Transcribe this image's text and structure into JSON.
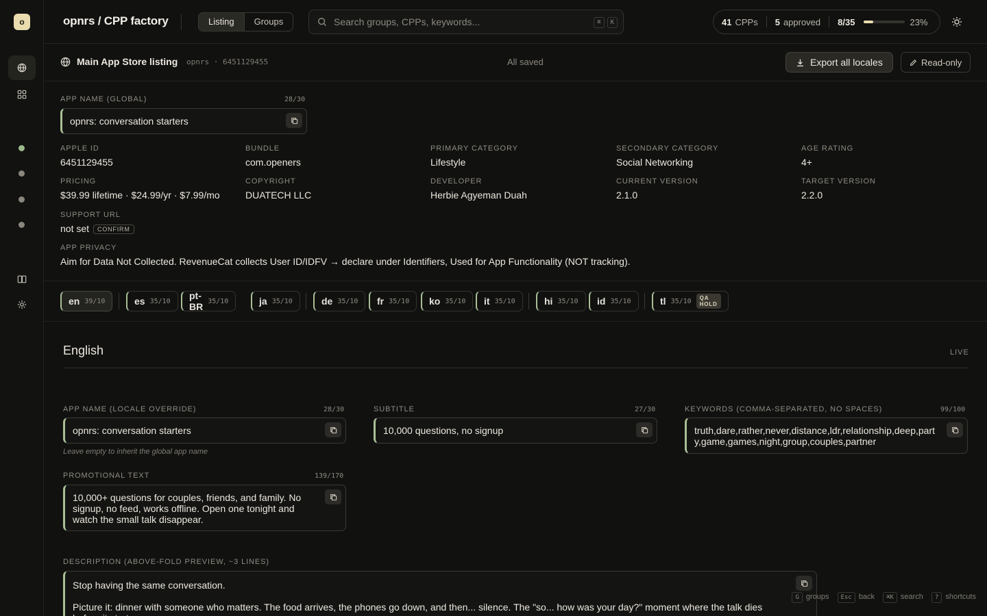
{
  "app": {
    "logo_letter": "o",
    "brand": "opnrs / CPP factory",
    "tabs": [
      "Listing",
      "Groups"
    ],
    "active_tab": "Listing"
  },
  "search": {
    "placeholder": "Search groups, CPPs, keywords...",
    "shortcut_keys": [
      "⌘",
      "K"
    ]
  },
  "stats": {
    "cpps_count": "41",
    "cpps_label": "CPPs",
    "approved_count": "5",
    "approved_label": "approved",
    "progress_text": "8/35",
    "progress_fraction": 0.23,
    "progress_percent": "23%"
  },
  "listing": {
    "title": "Main App Store listing",
    "meta": "opnrs · 6451129455",
    "save_status": "All saved",
    "export_label": "Export all locales",
    "readonly_label": "Read-only"
  },
  "global": {
    "app_name_label": "APP NAME (GLOBAL)",
    "app_name_counter": "28/30",
    "app_name_value": "opnrs: conversation starters",
    "info": [
      {
        "label": "APPLE ID",
        "value": "6451129455"
      },
      {
        "label": "BUNDLE",
        "value": "com.openers"
      },
      {
        "label": "PRIMARY CATEGORY",
        "value": "Lifestyle"
      },
      {
        "label": "SECONDARY CATEGORY",
        "value": "Social Networking"
      },
      {
        "label": "AGE RATING",
        "value": "4+"
      },
      {
        "label": "PRICING",
        "value": "$39.99 lifetime · $24.99/yr · $7.99/mo"
      },
      {
        "label": "COPYRIGHT",
        "value": "DUATECH LLC"
      },
      {
        "label": "DEVELOPER",
        "value": "Herbie Agyeman Duah"
      },
      {
        "label": "CURRENT VERSION",
        "value": "2.1.0"
      },
      {
        "label": "TARGET VERSION",
        "value": "2.2.0"
      }
    ],
    "support_url_label": "SUPPORT URL",
    "support_url_value": "not set",
    "support_url_tag": "CONFIRM",
    "privacy_label": "APP PRIVACY",
    "privacy_value": "Aim for Data Not Collected. RevenueCat collects User ID/IDFV → declare under Identifiers, Used for App Functionality (NOT tracking)."
  },
  "locales": [
    {
      "code": "en",
      "count": "39/10"
    },
    {
      "code": "es",
      "count": "35/10"
    },
    {
      "code": "pt-BR",
      "count": "35/10"
    },
    {
      "code": "ja",
      "count": "35/10"
    },
    {
      "code": "de",
      "count": "35/10"
    },
    {
      "code": "fr",
      "count": "35/10"
    },
    {
      "code": "ko",
      "count": "35/10"
    },
    {
      "code": "it",
      "count": "35/10"
    },
    {
      "code": "hi",
      "count": "35/10"
    },
    {
      "code": "id",
      "count": "35/10"
    },
    {
      "code": "tl",
      "count": "35/10",
      "badge": "QA HOLD"
    }
  ],
  "locale": {
    "name": "English",
    "status": "LIVE",
    "app_name_label": "APP NAME (LOCALE OVERRIDE)",
    "app_name_counter": "28/30",
    "app_name_value": "opnrs: conversation starters",
    "app_name_help": "Leave empty to inherit the global app name",
    "subtitle_label": "SUBTITLE",
    "subtitle_counter": "27/30",
    "subtitle_value": "10,000 questions, no signup",
    "keywords_label": "KEYWORDS (COMMA-SEPARATED, NO SPACES)",
    "keywords_counter": "99/100",
    "keywords_value": "truth,dare,rather,never,distance,ldr,relationship,deep,party,game,games,night,group,couples,partner",
    "promo_label": "PROMOTIONAL TEXT",
    "promo_counter": "139/170",
    "promo_value": "10,000+ questions for couples, friends, and family. No signup, no feed, works offline. Open one tonight and watch the small talk disappear.",
    "desc_label": "DESCRIPTION (ABOVE-FOLD PREVIEW, ~3 LINES)",
    "desc_line1": "Stop having the same conversation.",
    "desc_line2": "Picture it: dinner with someone who matters. The food arrives, the phones go down, and then... silence. The \"so... how was your day?\" moment where the talk dies before it starts."
  },
  "hints": [
    {
      "key": "G",
      "label": "groups"
    },
    {
      "key": "Esc",
      "label": "back"
    },
    {
      "key": "⌘K",
      "label": "search"
    },
    {
      "key": "?",
      "label": "shortcuts"
    }
  ],
  "colors": {
    "accent": "#e9dcae",
    "field_accent": "#a9bf96",
    "status_green": "#9bb98a"
  }
}
